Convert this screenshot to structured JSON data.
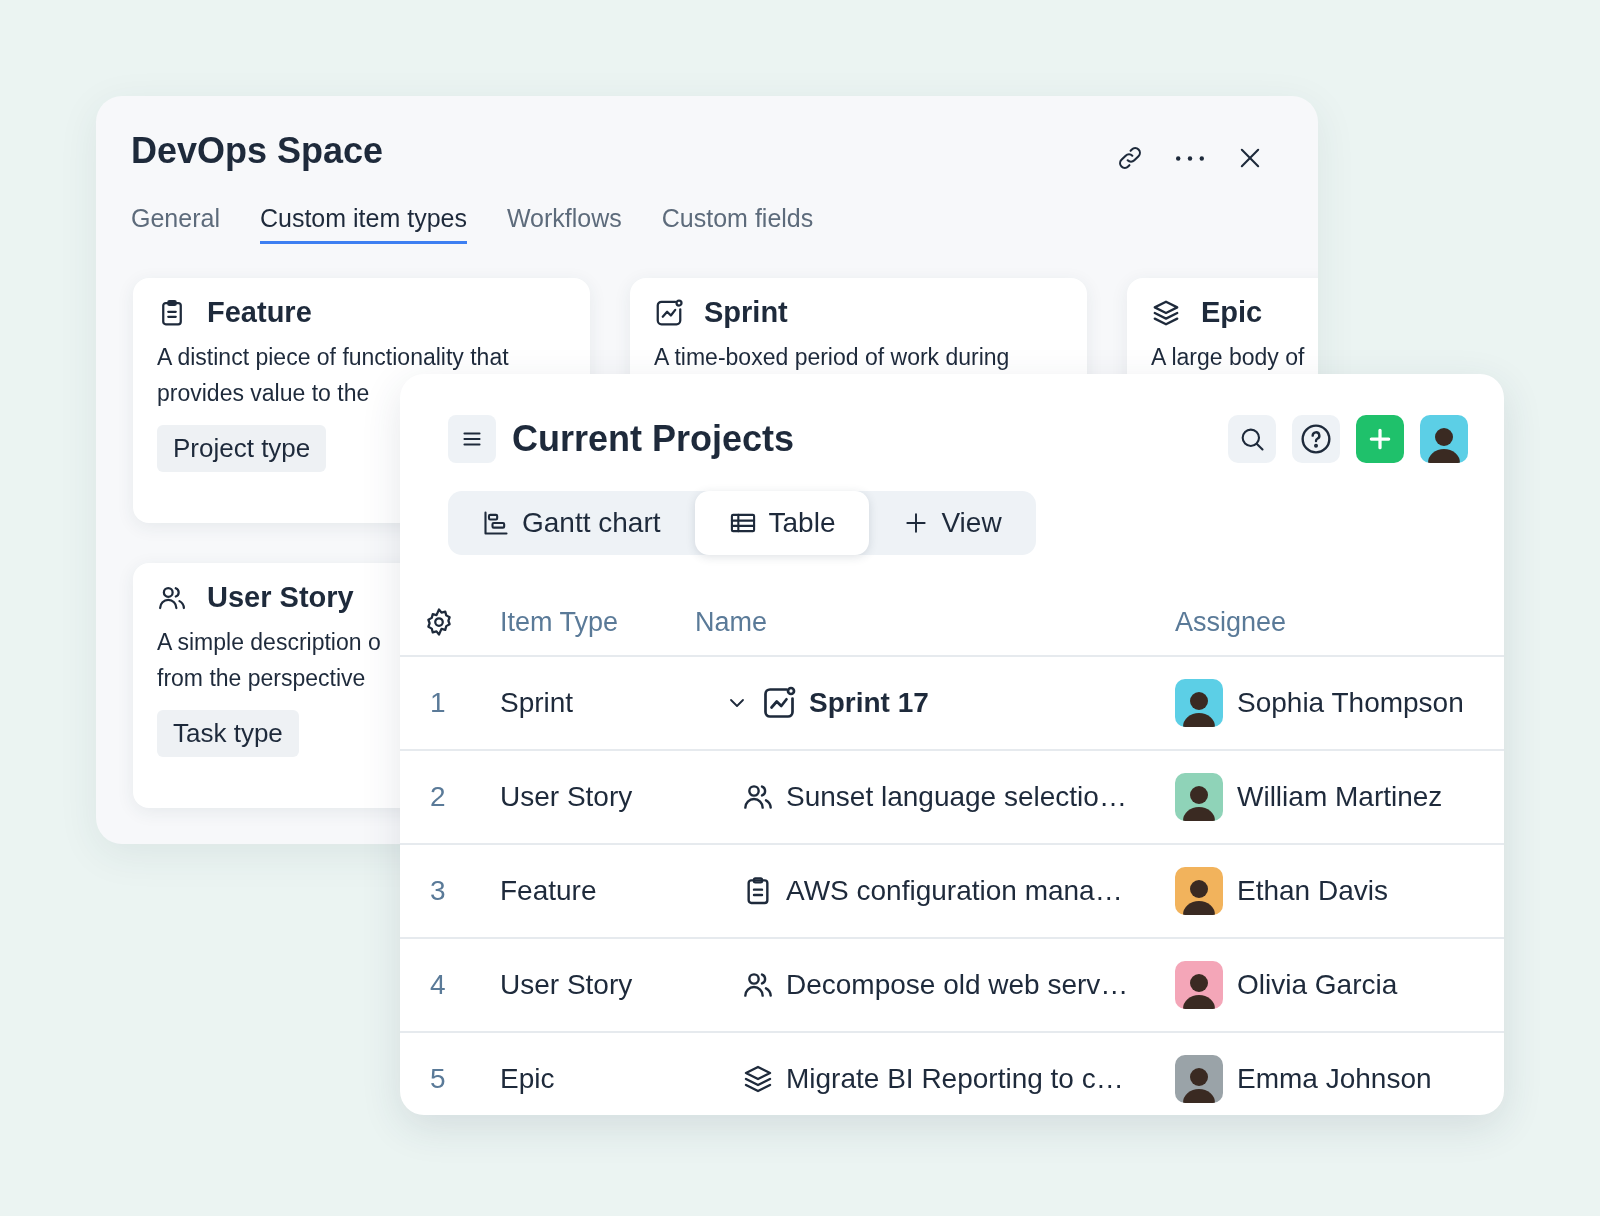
{
  "space_panel": {
    "title": "DevOps Space",
    "tabs": [
      {
        "label": "General",
        "selected": false
      },
      {
        "label": "Custom item types",
        "selected": true
      },
      {
        "label": "Workflows",
        "selected": false
      },
      {
        "label": "Custom fields",
        "selected": false
      }
    ],
    "cards": [
      {
        "kind": "feature",
        "title": "Feature",
        "description": [
          "A distinct piece of functionality that",
          "provides value to the"
        ],
        "tag": "Project type"
      },
      {
        "kind": "sprint",
        "title": "Sprint",
        "description": [
          "A time-boxed period of work during"
        ]
      },
      {
        "kind": "epic",
        "title": "Epic",
        "description": [
          "A large body of"
        ]
      },
      {
        "kind": "user_story",
        "title": "User Story",
        "description": [
          "A simple description o",
          "from the perspective"
        ],
        "tag": "Task type"
      }
    ]
  },
  "projects_panel": {
    "title": "Current Projects",
    "view_tabs": [
      {
        "kind": "gantt",
        "label": "Gantt chart",
        "selected": false
      },
      {
        "kind": "table",
        "label": "Table",
        "selected": true
      },
      {
        "kind": "add",
        "label": "View",
        "selected": false
      }
    ],
    "columns": [
      "Item Type",
      "Name",
      "Assignee"
    ],
    "rows": [
      {
        "number": "1",
        "item_type": "Sprint",
        "kind": "sprint",
        "name": "Sprint 17",
        "expanded": true,
        "assignee": "Sophia Thompson",
        "color": "#5ccfe6"
      },
      {
        "number": "2",
        "item_type": "User Story",
        "kind": "user_story",
        "name": "Sunset language selectio…",
        "expanded": false,
        "assignee": "William Martinez",
        "color": "#8fd3b8"
      },
      {
        "number": "3",
        "item_type": "Feature",
        "kind": "feature",
        "name": "AWS configuration mana…",
        "expanded": false,
        "assignee": "Ethan Davis",
        "color": "#f2b35c"
      },
      {
        "number": "4",
        "item_type": "User Story",
        "kind": "user_story",
        "name": "Decompose old web serv…",
        "expanded": false,
        "assignee": "Olivia Garcia",
        "color": "#f4a6b8"
      },
      {
        "number": "5",
        "item_type": "Epic",
        "kind": "epic",
        "name": "Migrate BI Reporting to c…",
        "expanded": false,
        "assignee": "Emma Johnson",
        "color": "#9aa3a8"
      }
    ]
  }
}
